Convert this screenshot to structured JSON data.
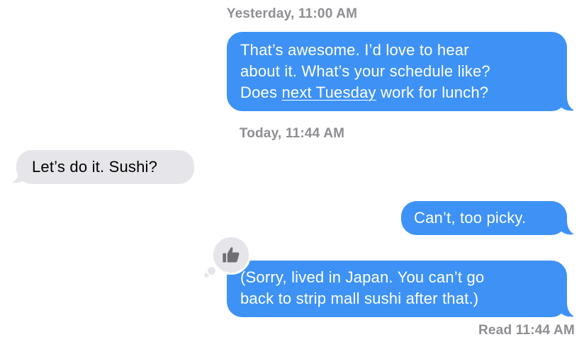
{
  "conversation": {
    "timestamps": [
      {
        "day": "Yesterday,",
        "time": "11:00 AM"
      },
      {
        "day": "Today,",
        "time": "11:44 AM"
      }
    ],
    "messages": [
      {
        "direction": "outgoing",
        "lines": [
          "That’s awesome. I’d love to hear",
          "about it. What’s your schedule like?"
        ],
        "line3_before": "Does ",
        "line3_link": "next Tuesday",
        "line3_after": " work for lunch?"
      },
      {
        "direction": "incoming",
        "lines": [
          "Let’s do it. Sushi?"
        ]
      },
      {
        "direction": "outgoing",
        "lines": [
          "Can’t, too picky."
        ]
      },
      {
        "direction": "outgoing",
        "lines": [
          "(Sorry, lived in Japan. You can’t go",
          "back to strip mall sushi after that.)"
        ],
        "tapback": "thumbs-up-icon"
      }
    ],
    "read_receipt": "Read 11:44 AM"
  },
  "colors": {
    "outgoing_bubble": "#3e92f5",
    "incoming_bubble": "#e6e5ea",
    "meta_text": "#8e8e93"
  }
}
